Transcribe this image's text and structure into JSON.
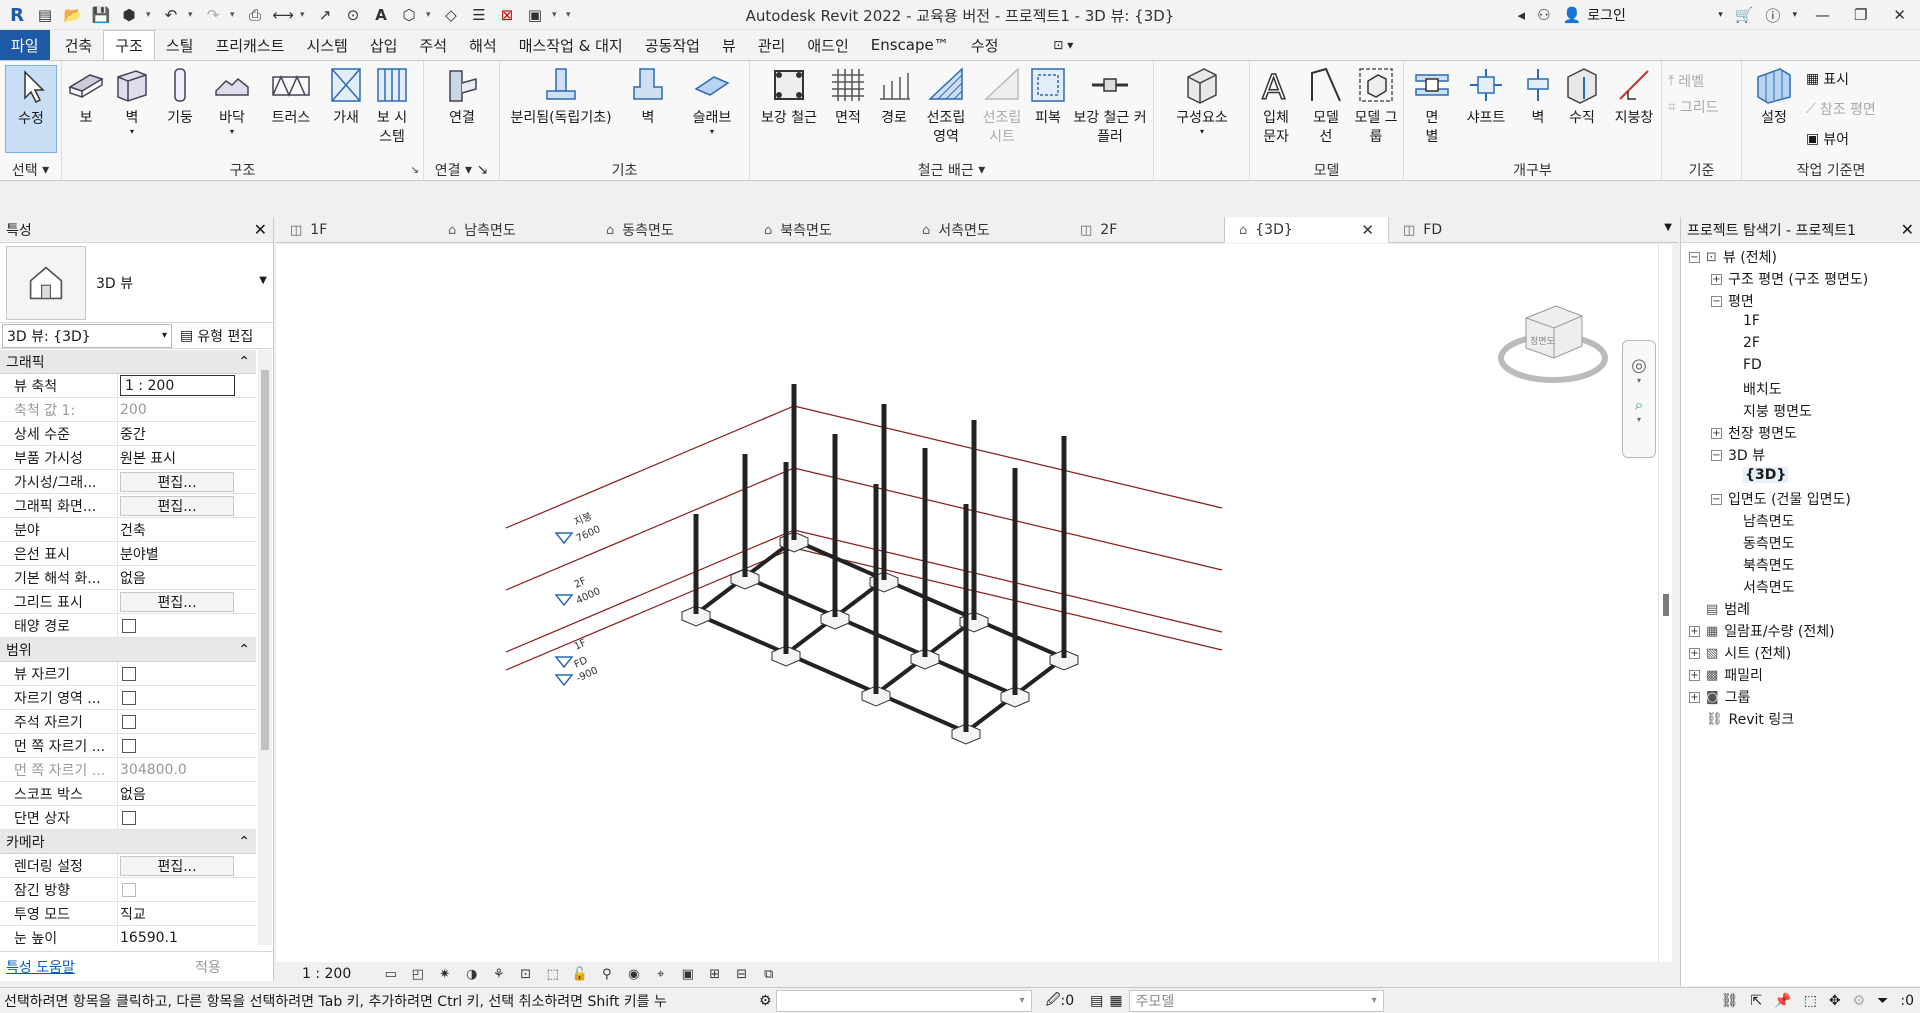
{
  "app": {
    "title": "Autodesk Revit 2022 - 교육용 버전 - 프로젝트1 - 3D 뷰: {3D}",
    "user": "로그인"
  },
  "menu": {
    "tabs": [
      "파일",
      "건축",
      "구조",
      "스틸",
      "프리캐스트",
      "시스템",
      "삽입",
      "주석",
      "해석",
      "매스작업 & 대지",
      "공동작업",
      "뷰",
      "관리",
      "애드인",
      "Enscape™",
      "수정"
    ],
    "active": "구조"
  },
  "ribbon": {
    "modify": {
      "label": "수정",
      "panel": "선택"
    },
    "structure": {
      "panel": "구조",
      "buttons": [
        "보",
        "벽",
        "기둥",
        "바닥",
        "트러스",
        "가새",
        "보 시스템"
      ]
    },
    "connection": {
      "panel": "연결",
      "buttons": [
        "연결"
      ]
    },
    "foundation": {
      "panel": "기초",
      "buttons": [
        "분리됨(독립기초)",
        "벽",
        "슬래브"
      ]
    },
    "rebar": {
      "panel": "철근 배근",
      "buttons": [
        "보강 철근",
        "면적",
        "경로",
        "선조립 영역",
        "선조립 시트",
        "피복",
        "보강 철근 커플러"
      ]
    },
    "component": {
      "buttons": [
        "구성요소"
      ]
    },
    "model": {
      "panel": "모델",
      "buttons": [
        "입체 문자",
        "모델 선",
        "모델 그룹"
      ]
    },
    "opening": {
      "panel": "개구부",
      "buttons": [
        "면 별",
        "샤프트",
        "벽",
        "수직",
        "지붕창"
      ]
    },
    "datum": {
      "panel": "기준",
      "buttons": [
        "레벨",
        "그리드"
      ]
    },
    "workplane": {
      "panel": "작업 기준면",
      "buttons": [
        "설정",
        "표시",
        "참조 평면",
        "뷰어"
      ]
    }
  },
  "properties": {
    "title": "특성",
    "type_name": "3D 뷰",
    "instance": "3D 뷰: {3D}",
    "edit_type": "유형 편집",
    "groups": [
      {
        "name": "그래픽",
        "rows": [
          {
            "k": "뷰 축척",
            "v": "1 : 200",
            "kind": "input"
          },
          {
            "k": "축척 값    1:",
            "v": "200",
            "kind": "dis"
          },
          {
            "k": "상세 수준",
            "v": "중간"
          },
          {
            "k": "부품 가시성",
            "v": "원본 표시"
          },
          {
            "k": "가시성/그래...",
            "v": "편집...",
            "kind": "btn"
          },
          {
            "k": "그래픽 화면...",
            "v": "편집...",
            "kind": "btn"
          },
          {
            "k": "분야",
            "v": "건축"
          },
          {
            "k": "은선 표시",
            "v": "분야별"
          },
          {
            "k": "기본 해석 화...",
            "v": "없음"
          },
          {
            "k": "그리드 표시",
            "v": "편집...",
            "kind": "btn"
          },
          {
            "k": "태양 경로",
            "v": "",
            "kind": "cb"
          }
        ]
      },
      {
        "name": "범위",
        "rows": [
          {
            "k": "뷰 자르기",
            "v": "",
            "kind": "cb"
          },
          {
            "k": "자르기 영역 ...",
            "v": "",
            "kind": "cb"
          },
          {
            "k": "주석 자르기",
            "v": "",
            "kind": "cb"
          },
          {
            "k": "먼 쪽 자르기 ...",
            "v": "",
            "kind": "cb"
          },
          {
            "k": "먼 쪽 자르기 ...",
            "v": "304800.0",
            "kind": "dis"
          },
          {
            "k": "스코프 박스",
            "v": "없음"
          },
          {
            "k": "단면 상자",
            "v": "",
            "kind": "cb"
          }
        ]
      },
      {
        "name": "카메라",
        "rows": [
          {
            "k": "렌더링 설정",
            "v": "편집...",
            "kind": "btn"
          },
          {
            "k": "잠긴 방향",
            "v": "",
            "kind": "cbdis"
          },
          {
            "k": "투영 모드",
            "v": "직교"
          },
          {
            "k": "눈 높이",
            "v": "16590.1"
          }
        ]
      }
    ],
    "help": "특성 도움말",
    "apply": "적용"
  },
  "views": {
    "tabs": [
      "1F",
      "남측면도",
      "동측면도",
      "북측면도",
      "서측면도",
      "2F",
      "{3D}",
      "FD"
    ],
    "active": "{3D}"
  },
  "canvas": {
    "levels": [
      {
        "name": "지붕",
        "elev": "7600"
      },
      {
        "name": "2F",
        "elev": "4000"
      },
      {
        "name": "1F",
        "elev": "0"
      },
      {
        "name": "FD",
        "elev": "-900"
      }
    ],
    "viewcube_face": "정면도"
  },
  "viewbar": {
    "scale": "1 : 200"
  },
  "browser": {
    "title": "프로젝트 탐색기 - 프로젝트1",
    "nodes": [
      {
        "t": "뷰 (전체)",
        "lvl": 0,
        "pm": "-"
      },
      {
        "t": "구조 평면 (구조 평면도)",
        "lvl": 1,
        "pm": "+"
      },
      {
        "t": "평면",
        "lvl": 1,
        "pm": "-"
      },
      {
        "t": "1F",
        "lvl": 2
      },
      {
        "t": "2F",
        "lvl": 2
      },
      {
        "t": "FD",
        "lvl": 2
      },
      {
        "t": "배치도",
        "lvl": 2
      },
      {
        "t": "지붕 평면도",
        "lvl": 2
      },
      {
        "t": "천장 평면도",
        "lvl": 1,
        "pm": "+"
      },
      {
        "t": "3D 뷰",
        "lvl": 1,
        "pm": "-"
      },
      {
        "t": "{3D}",
        "lvl": 2,
        "bold": true
      },
      {
        "t": "입면도 (건물 입면도)",
        "lvl": 1,
        "pm": "-"
      },
      {
        "t": "남측면도",
        "lvl": 2
      },
      {
        "t": "동측면도",
        "lvl": 2
      },
      {
        "t": "북측면도",
        "lvl": 2
      },
      {
        "t": "서측면도",
        "lvl": 2
      },
      {
        "t": "범례",
        "lvl": 0,
        "icon": true
      },
      {
        "t": "일람표/수량 (전체)",
        "lvl": 0,
        "pm": "+",
        "icon": true
      },
      {
        "t": "시트 (전체)",
        "lvl": 0,
        "pm": "+",
        "icon": true
      },
      {
        "t": "패밀리",
        "lvl": 0,
        "pm": "+",
        "icon": true
      },
      {
        "t": "그룹",
        "lvl": 0,
        "pm": "+",
        "icon": true
      },
      {
        "t": "Revit 링크",
        "lvl": 0,
        "icon": true
      }
    ]
  },
  "status": {
    "message": "선택하려면 항목을 클릭하고, 다른 항목을 선택하려면 Tab 키, 추가하려면 Ctrl 키, 선택 취소하려면 Shift 키를 누",
    "workset": ":0",
    "model": "주모델",
    "filter": ":0"
  }
}
